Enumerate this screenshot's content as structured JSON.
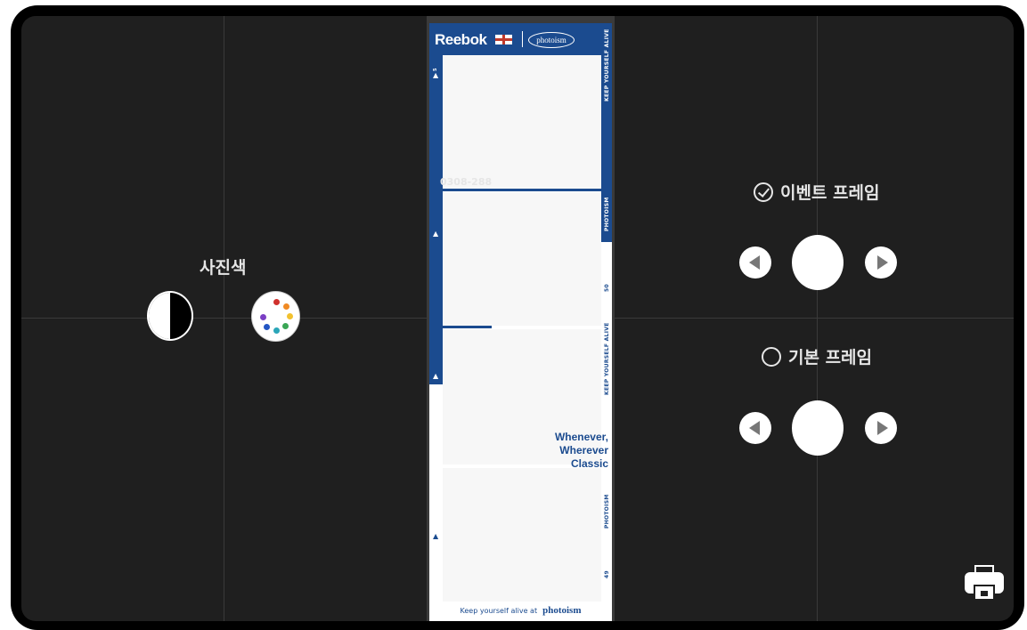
{
  "left_panel": {
    "photo_color_label": "사진색"
  },
  "strip": {
    "brand": "Reebok",
    "partner_logo": "photoism",
    "frame_numbers": {
      "top": "5",
      "mid": "50",
      "bottom": "49"
    },
    "side_text": {
      "keep_alive": "KEEP YOURSELF ALIVE",
      "photoism": "PHOTOISM"
    },
    "overlay_code": "0308-288",
    "tagline": {
      "line1": "Whenever,",
      "line2": "Wherever",
      "line3": "Classic"
    },
    "footer_text": "Keep yourself alive at",
    "footer_brand": "photoism"
  },
  "right_panel": {
    "event_frame_label": "이벤트 프레임",
    "basic_frame_label": "기본 프레임"
  },
  "colors": {
    "brand_blue": "#1b4b8f",
    "background": "#1f1f1f"
  },
  "icons": {
    "contrast": "contrast-icon",
    "palette": "palette-icon",
    "check": "check-circle-icon",
    "radio": "radio-empty-icon",
    "prev": "arrow-left-icon",
    "next": "arrow-right-icon",
    "print": "printer-icon"
  }
}
